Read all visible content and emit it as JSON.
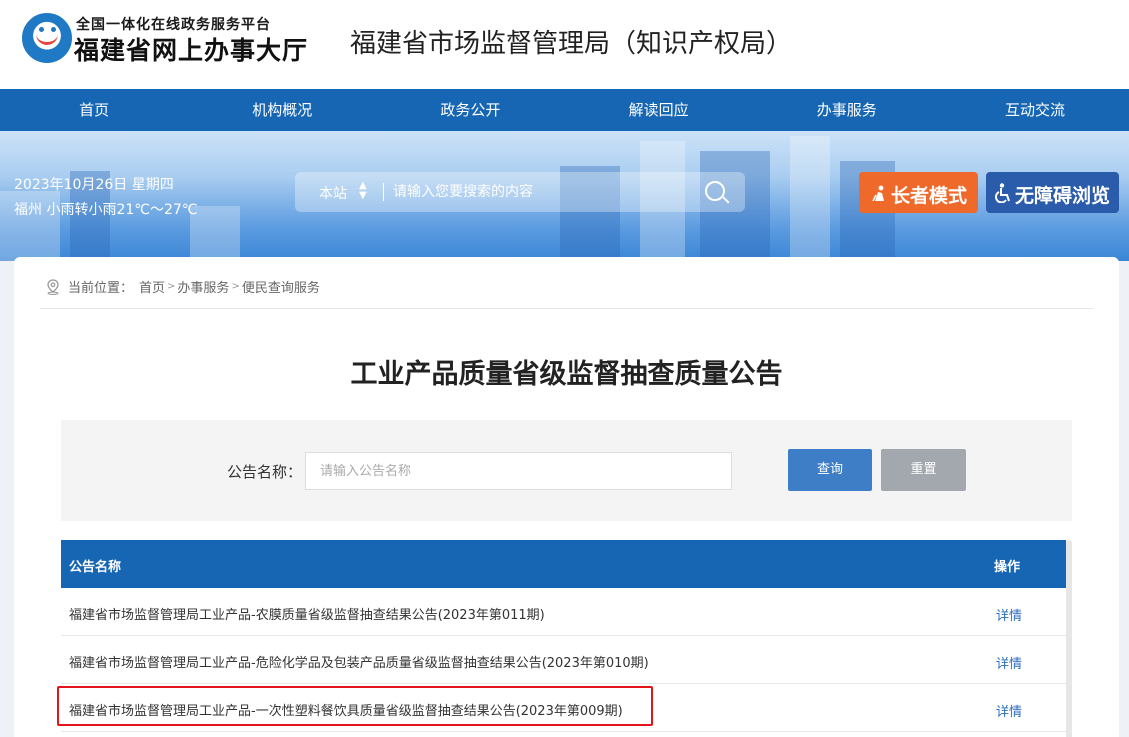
{
  "header": {
    "platform_sub": "全国一体化在线政务服务平台",
    "platform_main": "福建省网上办事大厅",
    "org_title": "福建省市场监督管理局（知识产权局）"
  },
  "nav": {
    "items": [
      {
        "label": "首页"
      },
      {
        "label": "机构概况"
      },
      {
        "label": "政务公开"
      },
      {
        "label": "解读回应"
      },
      {
        "label": "办事服务"
      },
      {
        "label": "互动交流"
      }
    ]
  },
  "banner": {
    "date": "2023年10月26日 星期四",
    "weather": "福州 小雨转小雨21℃～27℃",
    "search": {
      "scope": "本站",
      "placeholder": "请输入您要搜索的内容"
    },
    "elder_mode": "长者模式",
    "accessible": "无障碍浏览"
  },
  "breadcrumb": {
    "prefix": "当前位置：",
    "items": [
      "首页",
      "办事服务",
      "便民查询服务"
    ]
  },
  "page": {
    "title": "工业产品质量省级监督抽查质量公告"
  },
  "filter": {
    "label": "公告名称：",
    "placeholder": "请输入公告名称",
    "query_label": "查询",
    "reset_label": "重置"
  },
  "table": {
    "headers": {
      "name": "公告名称",
      "op": "操作"
    },
    "rows": [
      {
        "name": "福建省市场监督管理局工业产品-农膜质量省级监督抽查结果公告(2023年第011期)",
        "op": "详情"
      },
      {
        "name": "福建省市场监督管理局工业产品-危险化学品及包装产品质量省级监督抽查结果公告(2023年第010期)",
        "op": "详情"
      },
      {
        "name": "福建省市场监督管理局工业产品-一次性塑料餐饮具质量省级监督抽查结果公告(2023年第009期)",
        "op": "详情"
      }
    ]
  },
  "colors": {
    "nav_blue": "#1766b3",
    "elder_orange": "#ef6a2a",
    "access_blue": "#2b5bab",
    "highlight_red": "#e3151a"
  }
}
